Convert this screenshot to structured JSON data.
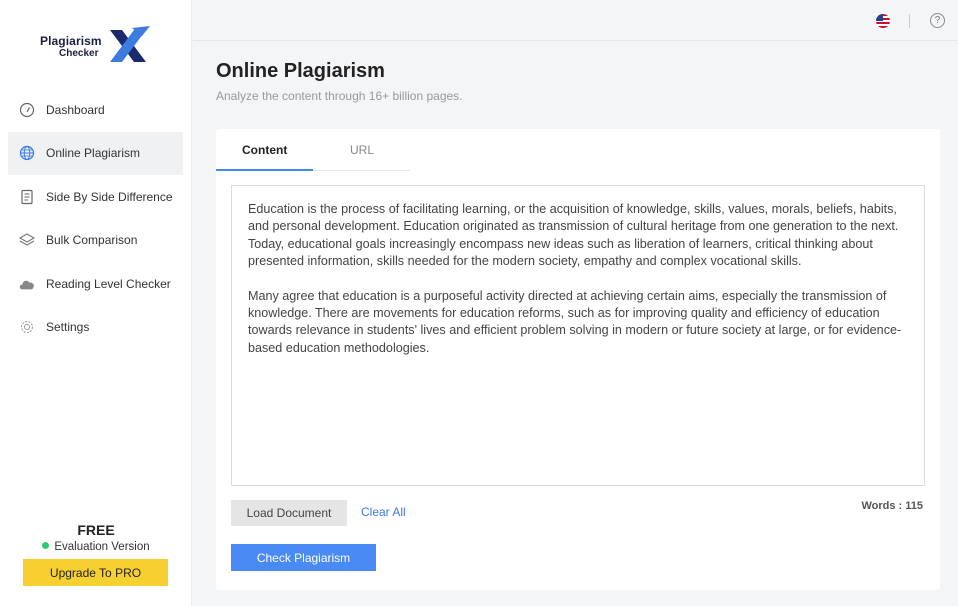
{
  "logo": {
    "line1": "Plagiarism",
    "line2": "Checker",
    "mark": "X"
  },
  "sidebar": {
    "items": [
      {
        "label": "Dashboard",
        "icon": "gauge-icon"
      },
      {
        "label": "Online Plagiarism",
        "icon": "globe-icon"
      },
      {
        "label": "Side By Side Difference",
        "icon": "document-icon"
      },
      {
        "label": "Bulk Comparison",
        "icon": "layers-icon"
      },
      {
        "label": "Reading Level Checker",
        "icon": "cloud-icon"
      },
      {
        "label": "Settings",
        "icon": "gear-icon"
      }
    ],
    "plan": "FREE",
    "version": "Evaluation Version",
    "upgrade_label": "Upgrade To PRO"
  },
  "header": {
    "help_symbol": "?"
  },
  "main": {
    "title": "Online Plagiarism",
    "subtitle": "Analyze the content through 16+ billion pages.",
    "tabs": [
      {
        "label": "Content"
      },
      {
        "label": "URL"
      }
    ],
    "text": {
      "p1": "Education is the process of facilitating learning, or the acquisition of knowledge, skills, values, morals, beliefs, habits, and personal development. Education originated as transmission of cultural heritage from one generation to the next. Today, educational goals increasingly encompass new ideas such as liberation of learners, critical thinking about presented information, skills needed for the modern society, empathy and complex vocational skills.",
      "p2": "Many agree that education is a purposeful activity directed at achieving certain aims, especially the transmission of knowledge. There are movements for education reforms, such as for improving quality and efficiency of education towards relevance in students' lives and efficient problem solving in modern or future society at large, or for evidence-based education methodologies."
    },
    "load_label": "Load Document",
    "clear_label": "Clear All",
    "words_label": "Words : 115",
    "check_label": "Check Plagiarism"
  },
  "colors": {
    "accent": "#4a8af4",
    "upgrade": "#f6d031",
    "status_dot": "#2ecc71"
  }
}
